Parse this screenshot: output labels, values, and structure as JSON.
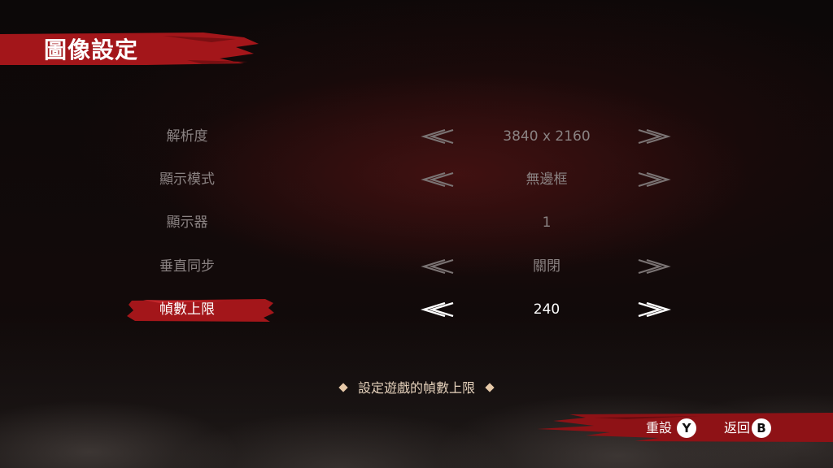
{
  "screen": {
    "title": "圖像設定"
  },
  "settings": [
    {
      "label": "解析度",
      "value": "3840 x 2160",
      "has_arrows": true
    },
    {
      "label": "顯示模式",
      "value": "無邊框",
      "has_arrows": true
    },
    {
      "label": "顯示器",
      "value": "1",
      "has_arrows": false
    },
    {
      "label": "垂直同步",
      "value": "關閉",
      "has_arrows": true
    },
    {
      "label": "幀數上限",
      "value": "240",
      "has_arrows": true,
      "selected": true
    }
  ],
  "hint": {
    "text": "設定遊戲的幀數上限"
  },
  "footer": {
    "reset_label": "重設",
    "reset_glyph": "Y",
    "back_label": "返回",
    "back_glyph": "B"
  },
  "colors": {
    "accent_red": "#a3161a",
    "text_dim": "#8a8282",
    "hint_text": "#e6d2bc"
  }
}
